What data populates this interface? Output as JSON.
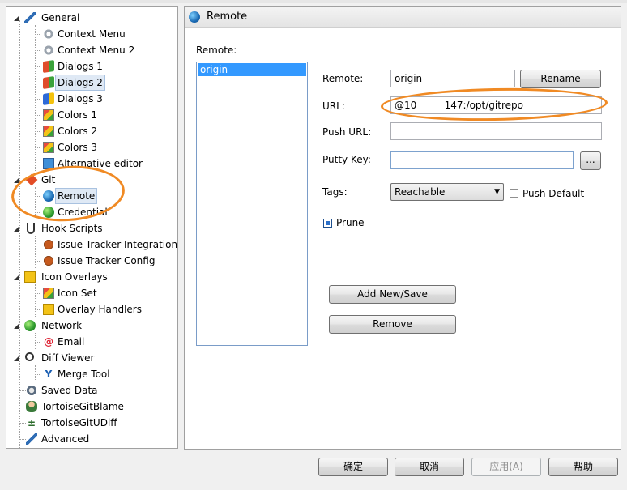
{
  "tree": {
    "items": [
      {
        "label": "General",
        "icon": "wrench-icon"
      },
      {
        "label": "Context Menu",
        "icon": "gear-icon"
      },
      {
        "label": "Context Menu 2",
        "icon": "gear-icon"
      },
      {
        "label": "Dialogs 1",
        "icon": "dialog-icon"
      },
      {
        "label": "Dialogs 2",
        "icon": "dialog-icon"
      },
      {
        "label": "Dialogs 3",
        "icon": "dialog-icon"
      },
      {
        "label": "Colors 1",
        "icon": "colors-icon"
      },
      {
        "label": "Colors 2",
        "icon": "colors-icon"
      },
      {
        "label": "Colors 3",
        "icon": "colors-icon"
      },
      {
        "label": "Alternative editor",
        "icon": "editor-icon"
      },
      {
        "label": "Git",
        "icon": "git-icon"
      },
      {
        "label": "Remote",
        "icon": "globe-icon"
      },
      {
        "label": "Credential",
        "icon": "credential-icon"
      },
      {
        "label": "Hook Scripts",
        "icon": "hook-icon"
      },
      {
        "label": "Issue Tracker Integration",
        "icon": "bug-icon"
      },
      {
        "label": "Issue Tracker Config",
        "icon": "bug-icon"
      },
      {
        "label": "Icon Overlays",
        "icon": "overlay-icon"
      },
      {
        "label": "Icon Set",
        "icon": "colors-icon"
      },
      {
        "label": "Overlay Handlers",
        "icon": "overlay-icon"
      },
      {
        "label": "Network",
        "icon": "network-icon"
      },
      {
        "label": "Email",
        "icon": "at-icon"
      },
      {
        "label": "Diff Viewer",
        "icon": "magnifier-icon"
      },
      {
        "label": "Merge Tool",
        "icon": "merge-icon"
      },
      {
        "label": "Saved Data",
        "icon": "saved-data-icon"
      },
      {
        "label": "TortoiseGitBlame",
        "icon": "blame-icon"
      },
      {
        "label": "TortoiseGitUDiff",
        "icon": "udiff-icon"
      },
      {
        "label": "Advanced",
        "icon": "wrench-icon"
      }
    ]
  },
  "panel": {
    "title": "Remote",
    "remote_list_label": "Remote:",
    "remotes": [
      "origin"
    ],
    "fields": {
      "remote_label": "Remote:",
      "remote_value": "origin",
      "url_label": "URL:",
      "url_value": "@10         147:/opt/gitrepo",
      "push_url_label": "Push URL:",
      "push_url_value": "",
      "putty_key_label": "Putty Key:",
      "putty_key_value": "",
      "tags_label": "Tags:",
      "tags_value": "Reachable"
    },
    "buttons": {
      "rename": "Rename",
      "browse": "...",
      "add_new_save": "Add New/Save",
      "remove": "Remove"
    },
    "checkboxes": {
      "push_default": {
        "label": "Push Default",
        "checked": false
      },
      "prune": {
        "label": "Prune",
        "checked": true
      }
    }
  },
  "footer": {
    "ok": "确定",
    "cancel": "取消",
    "apply": "应用(A)",
    "help": "帮助"
  },
  "colors": {
    "selection": "#3399ff",
    "annotation": "#f08a24"
  }
}
